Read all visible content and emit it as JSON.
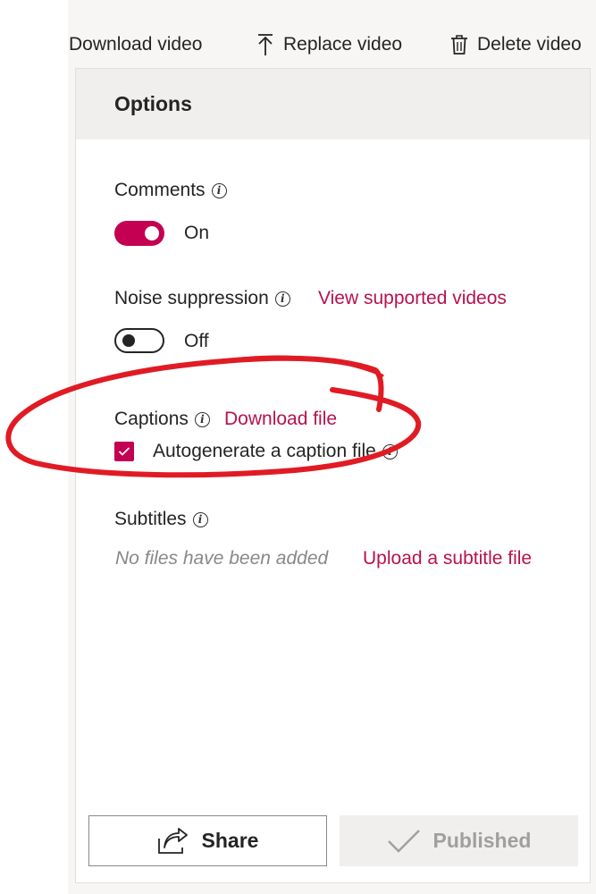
{
  "toolbar": {
    "download_label": "Download video",
    "replace_label": "Replace video",
    "delete_label": "Delete video"
  },
  "panel": {
    "title": "Options"
  },
  "comments": {
    "label": "Comments",
    "state": "On"
  },
  "noise": {
    "label": "Noise suppression",
    "link": "View supported videos",
    "state": "Off"
  },
  "captions": {
    "label": "Captions",
    "link": "Download file",
    "checkbox_label": "Autogenerate a caption file"
  },
  "subtitles": {
    "label": "Subtitles",
    "empty_text": "No files have been added",
    "upload_link": "Upload a subtitle file"
  },
  "footer": {
    "share_label": "Share",
    "published_label": "Published"
  },
  "colors": {
    "accent": "#c30052",
    "link": "#b7124e",
    "annotation": "#e01b24"
  },
  "icons": {
    "replace": "upload-arrow-icon",
    "delete": "trash-icon",
    "info": "info-icon",
    "share": "share-icon",
    "published": "checkmark-icon"
  }
}
